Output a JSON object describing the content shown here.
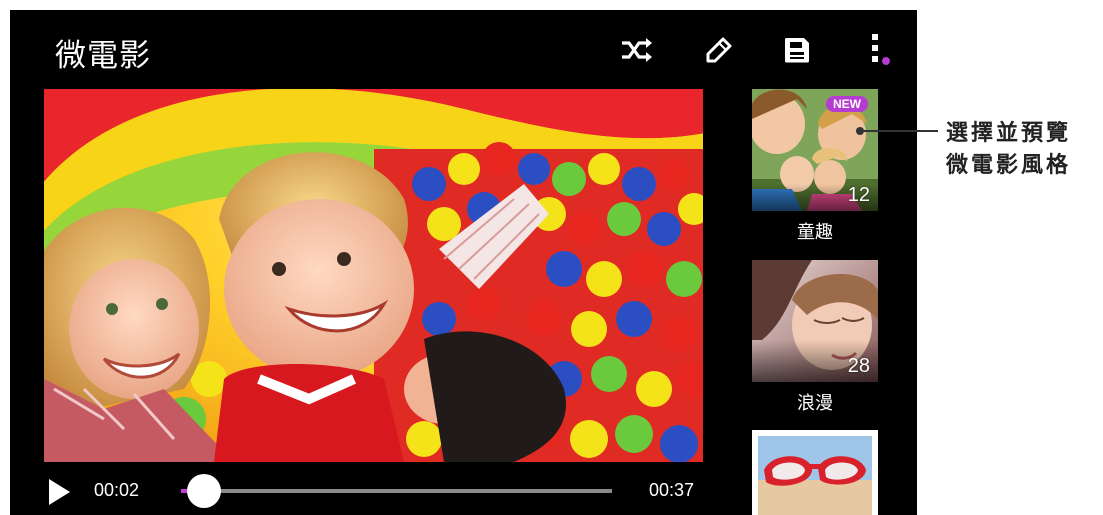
{
  "app": {
    "title": "微電影"
  },
  "toolbar": {
    "icons": [
      "shuffle-icon",
      "edit-icon",
      "save-icon",
      "more-options-icon"
    ],
    "notification_dot_color": "#b53bd3"
  },
  "player": {
    "current_time": "00:02",
    "total_time": "00:37",
    "progress": 0.054,
    "accent_color": "#c23bd6"
  },
  "styles": [
    {
      "label": "童趣",
      "count": "12",
      "badge": "NEW"
    },
    {
      "label": "浪漫",
      "count": "28"
    },
    {
      "label": ""
    }
  ],
  "callout": {
    "text": "選擇並預覽\n微電影風格"
  }
}
